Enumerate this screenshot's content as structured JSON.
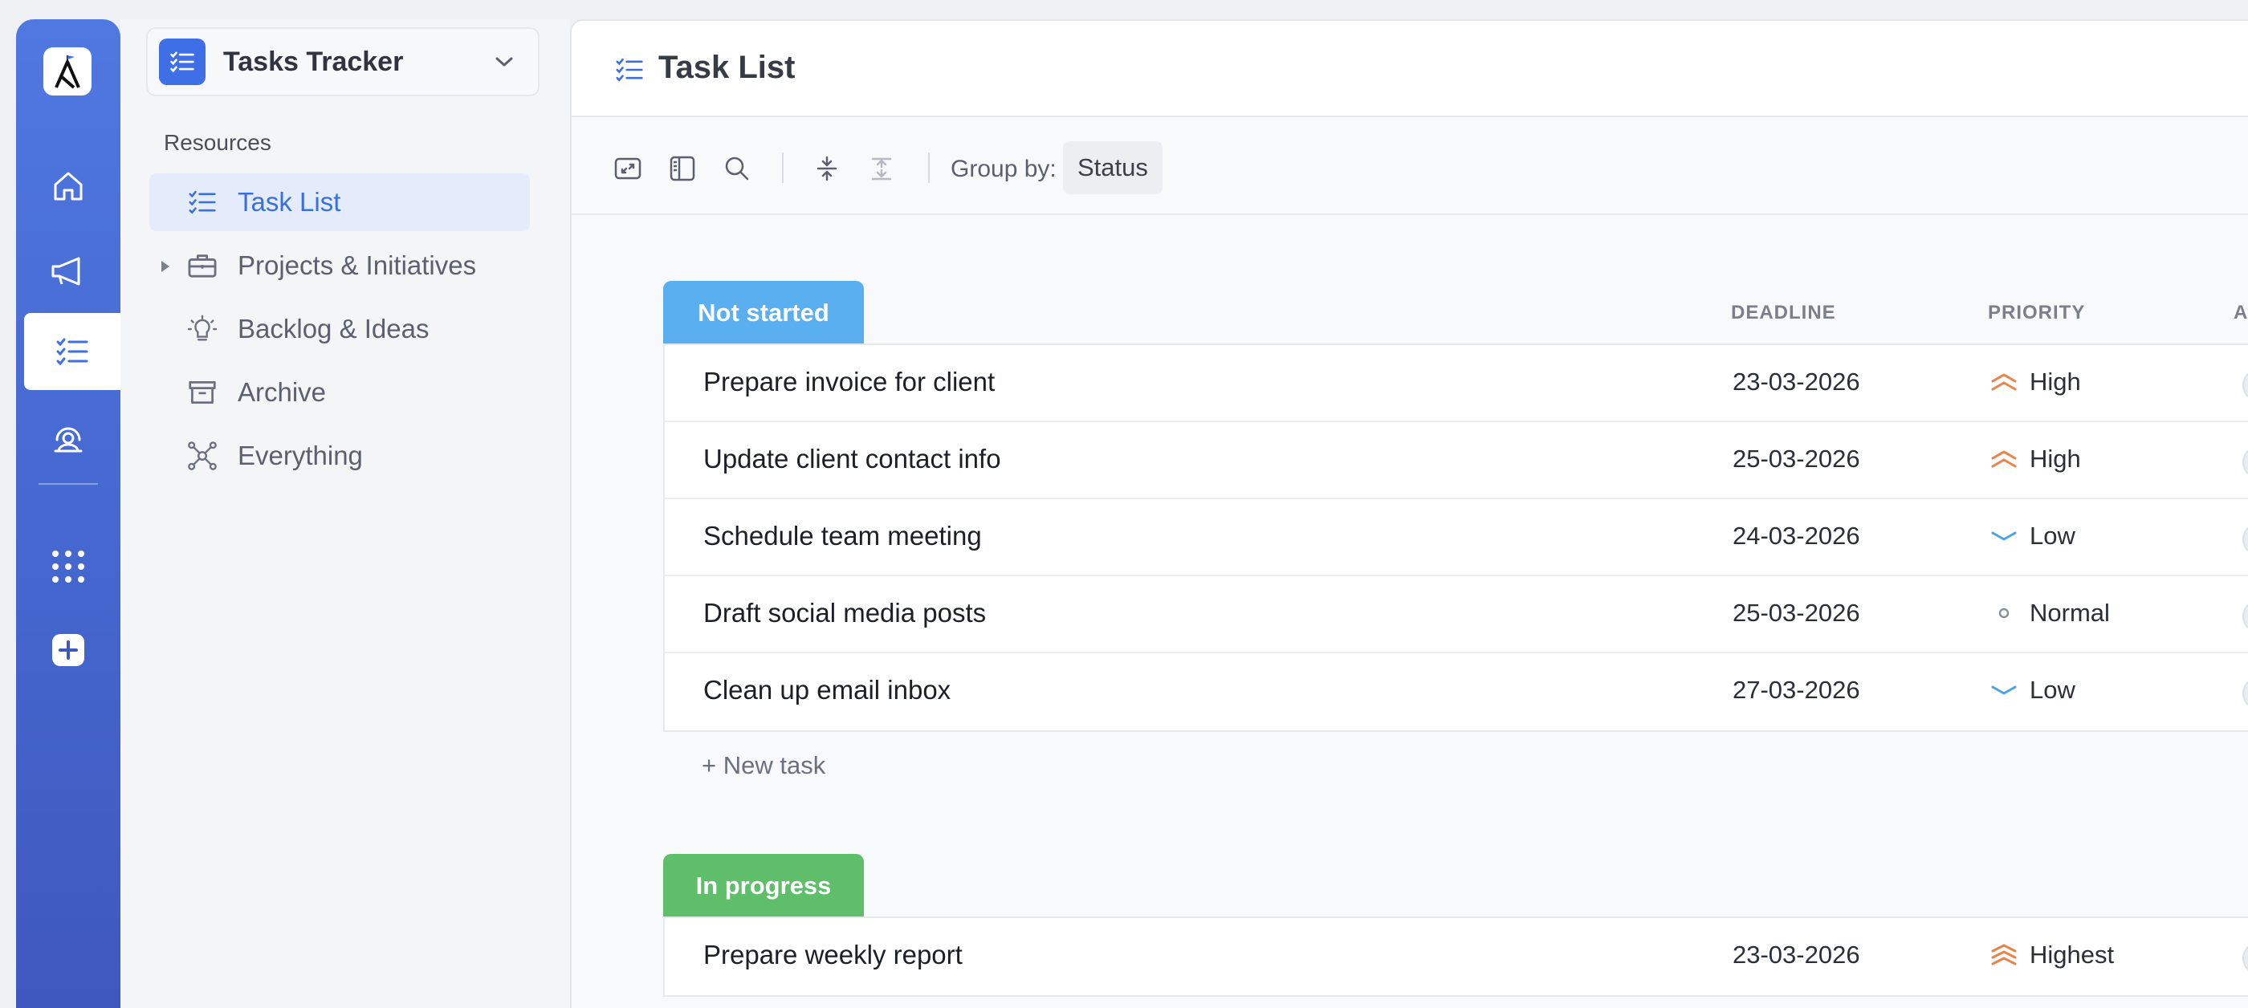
{
  "workspace": {
    "title": "Tasks Tracker"
  },
  "sidebar": {
    "heading": "Resources",
    "items": [
      {
        "label": "Task List",
        "icon": "task-list-icon",
        "active": true
      },
      {
        "label": "Projects & Initiatives",
        "icon": "briefcase-icon",
        "active": false
      },
      {
        "label": "Backlog & Ideas",
        "icon": "lightbulb-icon",
        "active": false
      },
      {
        "label": "Archive",
        "icon": "archive-icon",
        "active": false
      },
      {
        "label": "Everything",
        "icon": "graph-icon",
        "active": false
      }
    ]
  },
  "rail": {
    "items": [
      "home-icon",
      "megaphone-icon",
      "task-list-icon",
      "headset-icon",
      "apps-grid-icon",
      "plus-icon"
    ]
  },
  "main": {
    "title": "Task List",
    "toolbar": {
      "group_by_label": "Group by:",
      "group_by_value": "Status"
    },
    "columns": {
      "deadline": "DEADLINE",
      "priority": "PRIORITY",
      "assignee_partial": "A"
    },
    "new_task_label": "+ New task",
    "groups": [
      {
        "name": "Not started",
        "color": "#5aaff0",
        "tasks": [
          {
            "name": "Prepare invoice for client",
            "deadline": "23-03-2026",
            "priority": "High"
          },
          {
            "name": "Update client contact info",
            "deadline": "25-03-2026",
            "priority": "High"
          },
          {
            "name": "Schedule team meeting",
            "deadline": "24-03-2026",
            "priority": "Low"
          },
          {
            "name": "Draft social media posts",
            "deadline": "25-03-2026",
            "priority": "Normal"
          },
          {
            "name": "Clean up email inbox",
            "deadline": "27-03-2026",
            "priority": "Low"
          }
        ]
      },
      {
        "name": "In progress",
        "color": "#5fbe69",
        "tasks": [
          {
            "name": "Prepare weekly report",
            "deadline": "23-03-2026",
            "priority": "Highest"
          }
        ]
      }
    ]
  },
  "colors": {
    "accent": "#3f6fe6",
    "priority_high": "#e8834a",
    "priority_low": "#4ba3e3",
    "priority_normal": "#8a8f99"
  }
}
